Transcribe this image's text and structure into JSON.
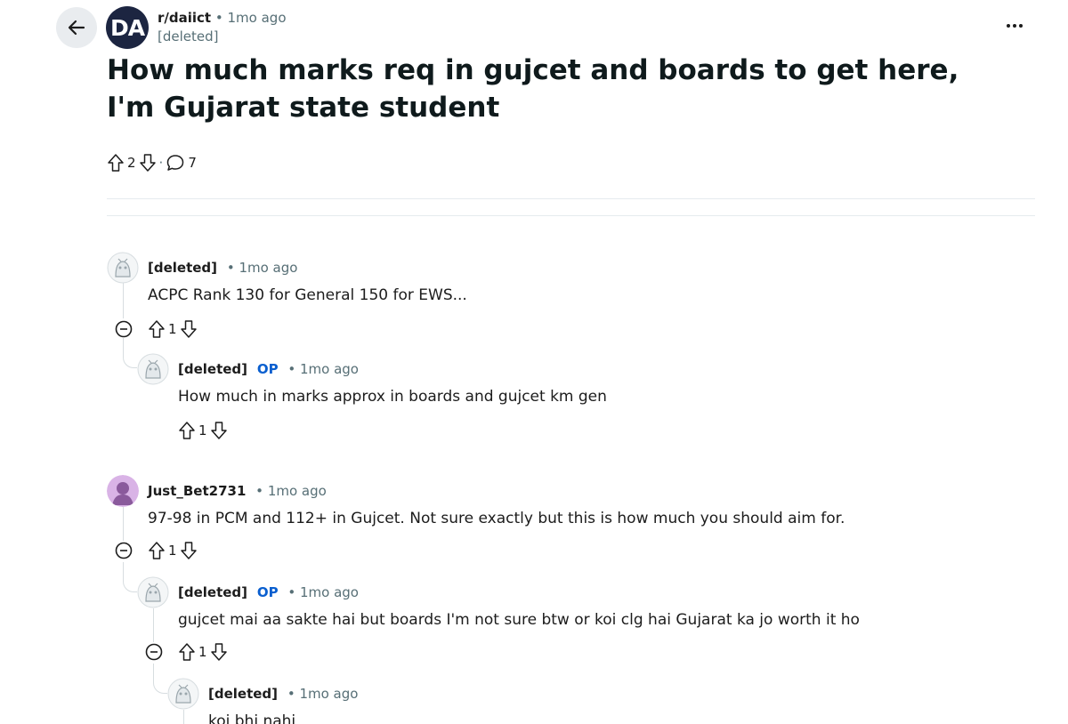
{
  "post": {
    "subreddit": "r/daiict",
    "subreddit_avatar_text": "DA",
    "time": "1mo ago",
    "author": "[deleted]",
    "title": "How much marks req in gujcet and boards to get here, I'm Gujarat state student",
    "upvotes": "2",
    "separator": "·",
    "comments": "7"
  },
  "comments": [
    {
      "author": "[deleted]",
      "op": "",
      "time": "1mo ago",
      "body": "ACPC Rank 130 for General 150 for EWS...",
      "votes": "1"
    },
    {
      "author": "[deleted]",
      "op": "OP",
      "time": "1mo ago",
      "body": "How much in marks approx in boards and gujcet km gen",
      "votes": "1"
    },
    {
      "author": "Just_Bet2731",
      "op": "",
      "time": "1mo ago",
      "body": "97-98 in PCM and 112+ in Gujcet. Not sure exactly but this is how much you should aim for.",
      "votes": "1"
    },
    {
      "author": "[deleted]",
      "op": "OP",
      "time": "1mo ago",
      "body": "gujcet mai aa sakte hai but boards I'm not sure btw or koi clg hai Gujarat ka jo worth it ho",
      "votes": "1"
    },
    {
      "author": "[deleted]",
      "op": "",
      "time": "1mo ago",
      "body": "koi bhi nahi",
      "votes": ""
    }
  ],
  "meta_dot": "•",
  "icons": {
    "back": "arrow-left-icon",
    "more": "more-options-icon",
    "upvote": "upvote-arrow-icon",
    "downvote": "downvote-arrow-icon",
    "comment": "comment-bubble-icon",
    "collapse": "collapse-minus-icon"
  },
  "colors": {
    "op": "#0a5fcf",
    "avatar_bg": "#1c2541",
    "meta": "#576f76"
  }
}
